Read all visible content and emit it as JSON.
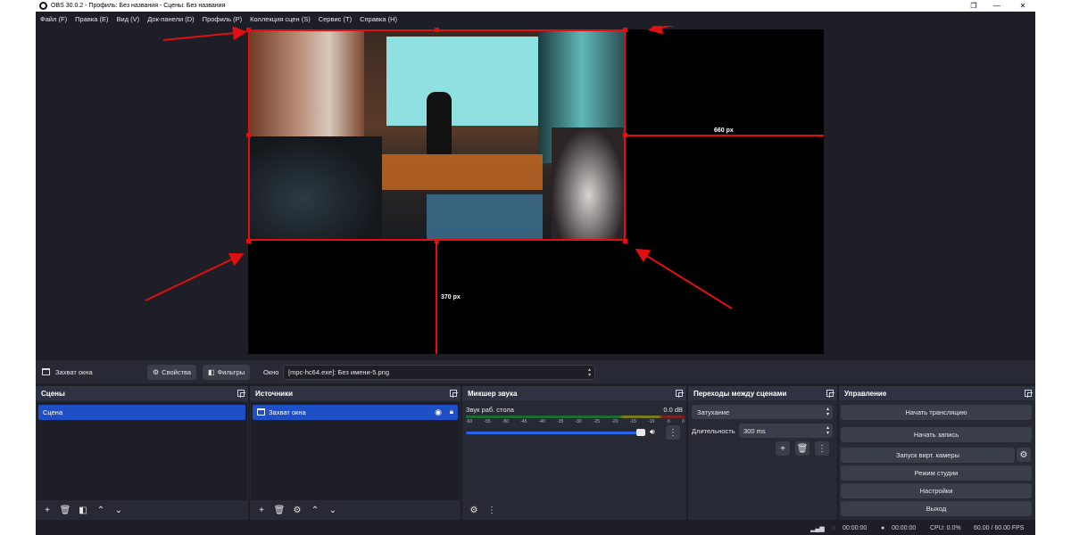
{
  "window": {
    "title": "OBS 30.0.2 - Профиль: Без названия - Сцены: Без названия",
    "minimize": "—",
    "maximize": "❐",
    "close": "✕"
  },
  "menu": [
    "Файл (F)",
    "Правка (E)",
    "Вид (V)",
    "Док-панели (D)",
    "Профиль (P)",
    "Коллекция сцен (S)",
    "Сервис (T)",
    "Справка (H)"
  ],
  "preview": {
    "guide_right_label": "660 px",
    "guide_bottom_label": "370 px",
    "accent_color": "#e01010"
  },
  "source_toolbar": {
    "source_name": "Захват окна",
    "properties_label": "Свойства",
    "filters_label": "Фильтры",
    "window_label": "Окно",
    "window_value": "[mpc-hc64.exe]: Без имени-5.png"
  },
  "scenes": {
    "title": "Сцены",
    "items": [
      "Сцена"
    ]
  },
  "sources": {
    "title": "Источники",
    "items": [
      {
        "name": "Захват окна",
        "visible_icon": "eye-icon",
        "lock_icon": "lock-icon"
      }
    ]
  },
  "mixer": {
    "title": "Микшер звука",
    "channel": "Звук раб. стола",
    "db": "0.0 dB",
    "scale": [
      "-60",
      "-55",
      "-50",
      "-45",
      "-40",
      "-35",
      "-30",
      "-25",
      "-20",
      "-15",
      "-10",
      "-5",
      "0"
    ]
  },
  "transitions": {
    "title": "Переходы между сценами",
    "transition": "Затухание",
    "duration_label": "Длительность",
    "duration_value": "300 ms"
  },
  "controls": {
    "title": "Управление",
    "start_stream": "Начать трансляцию",
    "start_record": "Начать запись",
    "virtual_cam": "Запуск вирт. камеры",
    "studio_mode": "Режим студии",
    "settings": "Настройки",
    "exit": "Выход"
  },
  "status": {
    "stream_time": "00:00:00",
    "record_time": "00:00:00",
    "cpu": "CPU: 0.0%",
    "fps": "60.00 / 60.00 FPS"
  },
  "colors": {
    "background": "#1d1e26",
    "panel": "#272934",
    "selection": "#1e4fc4",
    "accent_red": "#e01010"
  }
}
